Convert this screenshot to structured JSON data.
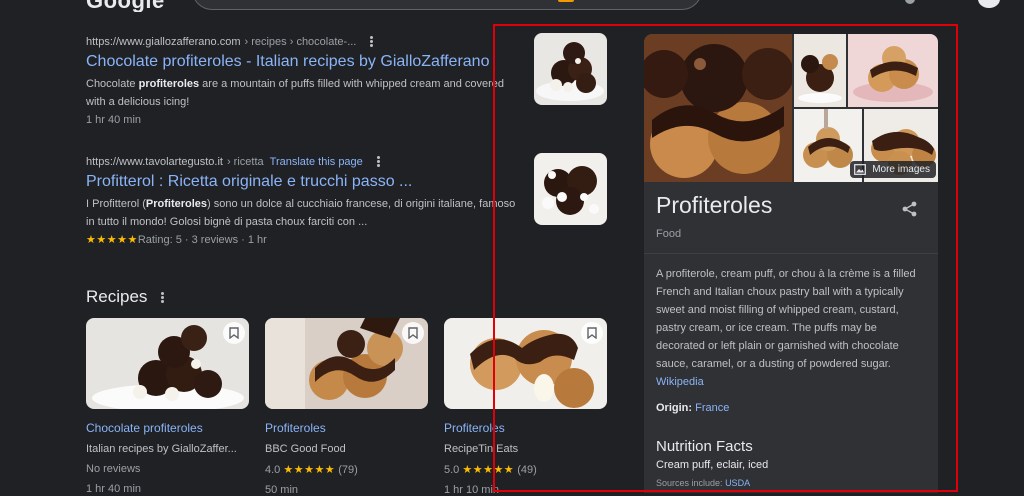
{
  "header": {
    "logo": "Google"
  },
  "results": [
    {
      "url_domain": "https://www.giallozafferano.com",
      "url_path": " › recipes › chocolate-...",
      "title": "Chocolate profiteroles - Italian recipes by GialloZafferano",
      "snippet_pre": "Chocolate ",
      "snippet_bold": "profiteroles",
      "snippet_post": " are a mountain of puffs filled with whipped cream and covered with a delicious icing!",
      "meta": "1 hr 40 min",
      "thumb_icon": "profiterole-thumbnail"
    },
    {
      "url_domain": "https://www.tavolartegusto.it",
      "url_path": " › ricetta",
      "translate": "Translate this page",
      "title": "Profitterol : Ricetta originale e trucchi passo ...",
      "snippet_pre": "I Profitterol (",
      "snippet_bold": "Profiteroles",
      "snippet_post": ") sono un dolce al cucchiaio francese, di origini italiane, famoso in tutto il mondo! Golosi bignè di pasta choux farciti con ...",
      "stars": "★★★★★",
      "meta": "Rating: 5 · 3 reviews · 1 hr",
      "thumb_icon": "profitterol-thumbnail"
    }
  ],
  "recipes": {
    "heading": "Recipes",
    "cards": [
      {
        "title": "Chocolate profiteroles",
        "source": "Italian recipes by GialloZaffer...",
        "rating_value": "",
        "stars": "",
        "reviews": "No reviews",
        "time": "1 hr 40 min"
      },
      {
        "title": "Profiteroles",
        "source": "BBC Good Food",
        "rating_value": "4.0",
        "stars": "★★★★★",
        "reviews": "(79)",
        "time": "50 min"
      },
      {
        "title": "Profiteroles",
        "source": "RecipeTin Eats",
        "rating_value": "5.0",
        "stars": "★★★★★",
        "reviews": "(49)",
        "time": "1 hr 10 min"
      }
    ]
  },
  "knowledge_panel": {
    "more_images": "More images",
    "title": "Profiteroles",
    "type": "Food",
    "description": "A profiterole, cream puff, or chou à la crème is a filled French and Italian choux pastry ball with a typically sweet and moist filling of whipped cream, custard, pastry cream, or ice cream. The puffs may be decorated or left plain or garnished with chocolate sauce, caramel, or a dusting of powdered sugar.",
    "source_link": "Wikipedia",
    "origin_label": "Origin:",
    "origin_value": "France",
    "nutrition_heading": "Nutrition Facts",
    "nutrition_sub": "Cream puff, eclair, iced",
    "sources_label": "Sources include:",
    "sources_value": "USDA"
  },
  "colors": {
    "background": "#202124",
    "link": "#8ab4f8",
    "highlight": "#e0000a",
    "stars": "#fbbc04"
  }
}
